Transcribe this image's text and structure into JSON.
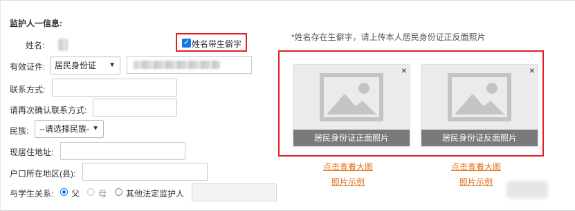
{
  "section": {
    "title": "监护人一信息:"
  },
  "name": {
    "label": "姓名:",
    "rare_char_checkbox": {
      "checked": true,
      "label": "姓名带生僻字"
    }
  },
  "hint": "*姓名存在生僻字，请上传本人居民身份证正反面照片",
  "id_doc": {
    "label": "有效证件:",
    "type_selected": "居民身份证"
  },
  "contact": {
    "label": "联系方式:"
  },
  "confirm_contact": {
    "label": "请再次确认联系方式:"
  },
  "ethnicity": {
    "label": "民族:",
    "selected": "--请选择民族-"
  },
  "address": {
    "label": "现居住地址:"
  },
  "hukou": {
    "label": "户口所在地区(县):"
  },
  "relation": {
    "label": "与学生关系:",
    "options": [
      {
        "label": "父",
        "selected": true,
        "disabled": false
      },
      {
        "label": "母",
        "selected": false,
        "disabled": true
      },
      {
        "label": "其他法定监护人",
        "selected": false,
        "disabled": false
      }
    ]
  },
  "uploads": [
    {
      "caption": "居民身份证正面照片",
      "view_link": "点击查看大图",
      "example_link": "照片示例",
      "close": "×",
      "icon": "image-placeholder-icon"
    },
    {
      "caption": "居民身份证反面照片",
      "view_link": "点击查看大图",
      "example_link": "照片示例",
      "close": "×",
      "icon": "image-placeholder-icon"
    }
  ],
  "colors": {
    "highlight": "#e02020",
    "link": "#e36f17",
    "caption_bg": "#7a7a7a",
    "accent": "#1a73e8"
  }
}
